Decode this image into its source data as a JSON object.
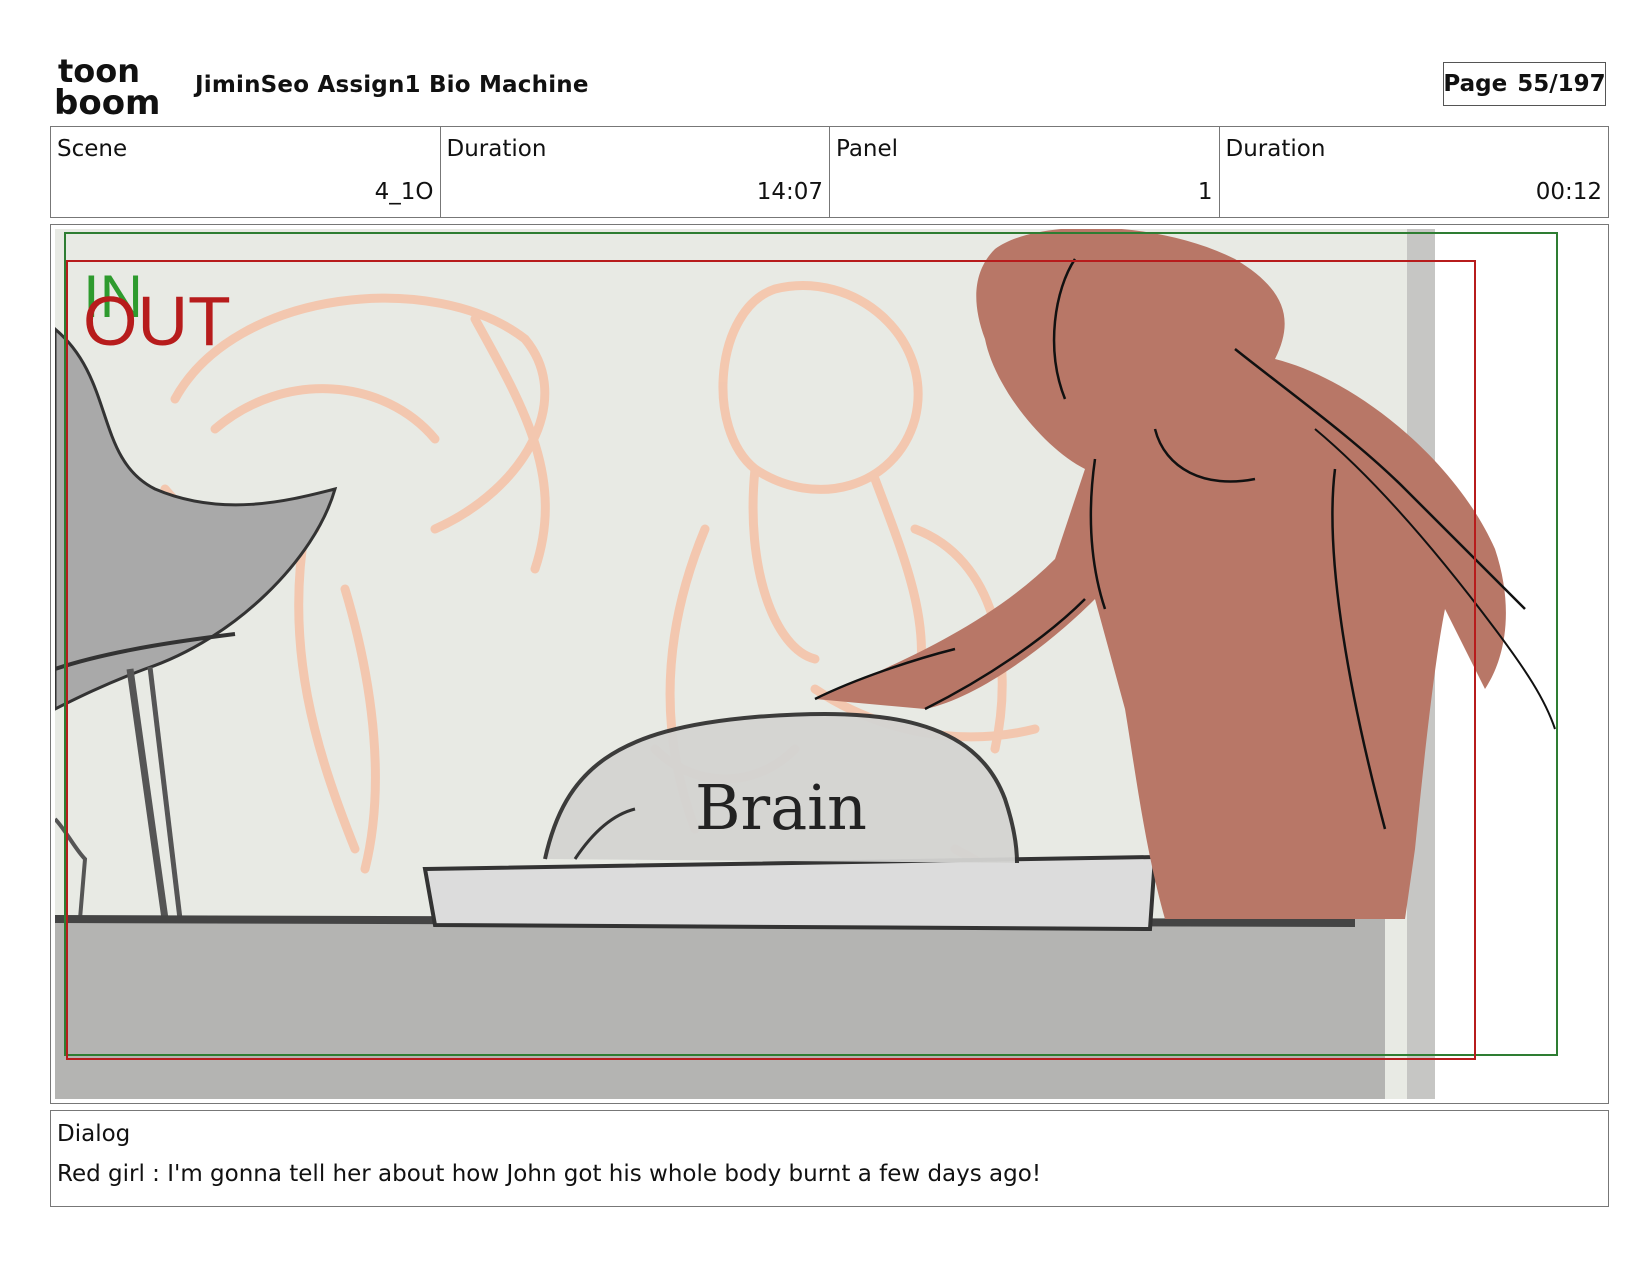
{
  "header": {
    "logo_icon": "toonboom-logo",
    "logo_text_top": "toon",
    "logo_text_bottom": "boom",
    "project_title": "JiminSeo Assign1 Bio Machine",
    "page_label": "Page",
    "page_value": "55/197"
  },
  "info": {
    "scene_label": "Scene",
    "scene_value": "4_1O",
    "scene_duration_label": "Duration",
    "scene_duration_value": "14:07",
    "panel_label": "Panel",
    "panel_value": "1",
    "panel_duration_label": "Duration",
    "panel_duration_value": "00:12"
  },
  "panel": {
    "in_label": "IN",
    "out_label": "OUT",
    "sketch_text": "Brain",
    "colors": {
      "in_frame": "#2e7d32",
      "out_frame": "#b71c1c",
      "background": "#e8eae4",
      "figure": "#b87767",
      "rough_sketch": "#f4b89a",
      "table": "#b4b4b2"
    }
  },
  "dialog": {
    "label": "Dialog",
    "text": "Red girl : I'm gonna tell her about how John got his whole body burnt a few days ago!"
  }
}
